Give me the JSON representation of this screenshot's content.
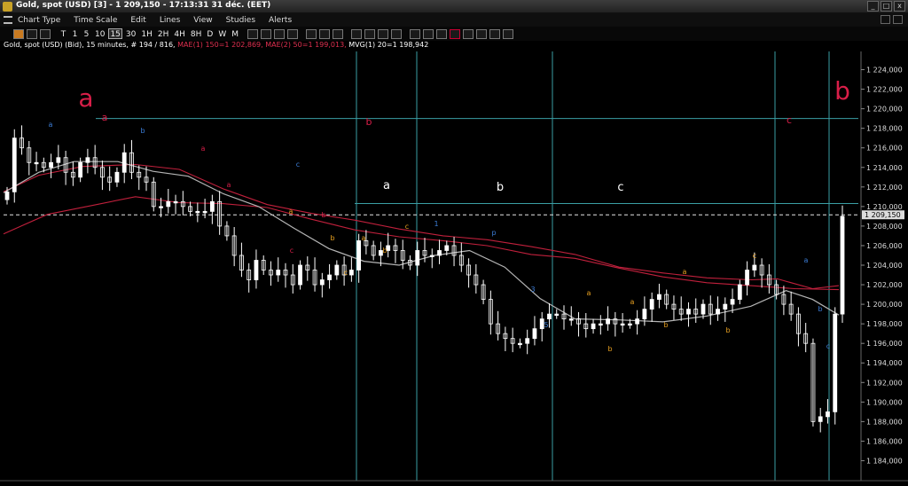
{
  "window": {
    "title": "Gold, spot (USD) [3] - 1 209,150 - 17:13:31  31 déc. (EET)",
    "controls": [
      "_",
      "□",
      "x"
    ]
  },
  "menu": [
    "Chart Type",
    "Time Scale",
    "Edit",
    "Lines",
    "View",
    "Studies",
    "Alerts"
  ],
  "toolbar": {
    "timeframes": [
      "T",
      "1",
      "5",
      "10",
      "15",
      "30",
      "1H",
      "2H",
      "4H",
      "8H",
      "D",
      "W",
      "M"
    ],
    "active_timeframe": "15"
  },
  "legend": {
    "instrument": "Gold, spot (USD) (Bid), 15 minutes, # 194 / 816,",
    "ma1": "MAE(1) 150=1 202,869,",
    "ma2": "MAE(2) 50=1 199,013,",
    "mvg": "MVG(1) 20=1 198,942"
  },
  "colors": {
    "background": "#000000",
    "candle": "#ffffff",
    "ma_red": "#c0203c",
    "ma_gray": "#b4b4b4",
    "cyan_line": "#3a9ea4",
    "wave_red": "#d81e48",
    "wave_orange": "#e8a020",
    "wave_blue": "#3c7ed8",
    "price_tag_bg": "#dcdcdc"
  },
  "chart_data": {
    "type": "candlestick",
    "y_unit": "USD",
    "ylim": [
      1182500,
      1225500
    ],
    "y_ticks": [
      "1 224,000",
      "1 222,000",
      "1 220,000",
      "1 218,000",
      "1 216,000",
      "1 214,000",
      "1 212,000",
      "1 210,000",
      "1 208,000",
      "1 206,000",
      "1 204,000",
      "1 202,000",
      "1 200,000",
      "1 198,000",
      "1 196,000",
      "1 194,000",
      "1 192,000",
      "1 190,000",
      "1 188,000",
      "1 186,000",
      "1 184,000"
    ],
    "y_tick_values": [
      1224000,
      1222000,
      1220000,
      1218000,
      1216000,
      1214000,
      1212000,
      1210000,
      1208000,
      1206000,
      1204000,
      1202000,
      1200000,
      1198000,
      1196000,
      1194000,
      1192000,
      1190000,
      1188000,
      1186000,
      1184000
    ],
    "last_price": "1 209,150",
    "last_price_value": 1209150,
    "close_series": [
      1211500,
      1217000,
      1216000,
      1214500,
      1214500,
      1214000,
      1214500,
      1215000,
      1213500,
      1213000,
      1214500,
      1215000,
      1214000,
      1213000,
      1212500,
      1213500,
      1215500,
      1213500,
      1213000,
      1212500,
      1210000,
      1210000,
      1210500,
      1210500,
      1210000,
      1209500,
      1209500,
      1209500,
      1210500,
      1208000,
      1207000,
      1205000,
      1203500,
      1202500,
      1204500,
      1203500,
      1203000,
      1203500,
      1203000,
      1202000,
      1204000,
      1203500,
      1202000,
      1202500,
      1203000,
      1204000,
      1203000,
      1203500,
      1206500,
      1206000,
      1205000,
      1205500,
      1206000,
      1205500,
      1204500,
      1204000,
      1205500,
      1205000,
      1205000,
      1205500,
      1206000,
      1205000,
      1204000,
      1203000,
      1202000,
      1200500,
      1198000,
      1197000,
      1196500,
      1196000,
      1196000,
      1196500,
      1197500,
      1198500,
      1199000,
      1199000,
      1198500,
      1198500,
      1198000,
      1197500,
      1198000,
      1198000,
      1198500,
      1198000,
      1198000,
      1198000,
      1198500,
      1199500,
      1200500,
      1201000,
      1200000,
      1199500,
      1199000,
      1199500,
      1199000,
      1200000,
      1199000,
      1199500,
      1200000,
      1200500,
      1202000,
      1203500,
      1204000,
      1203000,
      1202000,
      1201000,
      1200000,
      1199000,
      1197000,
      1196000,
      1188000,
      1188500,
      1189000,
      1199000,
      1209000
    ],
    "ma_series": [
      {
        "name": "MAE(1) 150",
        "values": [
          [
            0,
            1207200
          ],
          [
            50,
            1209200
          ],
          [
            100,
            1210100
          ],
          [
            150,
            1211000
          ],
          [
            200,
            1210400
          ],
          [
            250,
            1210300
          ],
          [
            300,
            1209900
          ],
          [
            350,
            1208700
          ],
          [
            400,
            1207600
          ],
          [
            450,
            1206900
          ],
          [
            500,
            1206500
          ],
          [
            550,
            1206000
          ],
          [
            600,
            1205100
          ],
          [
            650,
            1204700
          ],
          [
            700,
            1203700
          ],
          [
            750,
            1202800
          ],
          [
            800,
            1202200
          ],
          [
            850,
            1201900
          ],
          [
            900,
            1201600
          ],
          [
            950,
            1201500
          ]
        ]
      },
      {
        "name": "MAE(2) 50",
        "values": [
          [
            0,
            1211500
          ],
          [
            40,
            1213200
          ],
          [
            90,
            1214100
          ],
          [
            150,
            1214300
          ],
          [
            200,
            1213800
          ],
          [
            250,
            1211800
          ],
          [
            300,
            1210200
          ],
          [
            350,
            1209300
          ],
          [
            400,
            1208600
          ],
          [
            450,
            1207700
          ],
          [
            500,
            1207000
          ],
          [
            550,
            1206600
          ],
          [
            600,
            1205900
          ],
          [
            650,
            1205100
          ],
          [
            700,
            1203800
          ],
          [
            750,
            1203200
          ],
          [
            800,
            1202700
          ],
          [
            850,
            1202500
          ],
          [
            880,
            1202600
          ],
          [
            920,
            1201600
          ],
          [
            950,
            1201900
          ]
        ]
      },
      {
        "name": "MVG(1) 20",
        "values": [
          [
            0,
            1211400
          ],
          [
            40,
            1213500
          ],
          [
            80,
            1214600
          ],
          [
            130,
            1214600
          ],
          [
            170,
            1213600
          ],
          [
            210,
            1213100
          ],
          [
            250,
            1211300
          ],
          [
            290,
            1210000
          ],
          [
            330,
            1207800
          ],
          [
            370,
            1205700
          ],
          [
            410,
            1204400
          ],
          [
            450,
            1204000
          ],
          [
            490,
            1205000
          ],
          [
            530,
            1205500
          ],
          [
            570,
            1203800
          ],
          [
            610,
            1200600
          ],
          [
            650,
            1198500
          ],
          [
            700,
            1198400
          ],
          [
            750,
            1198200
          ],
          [
            800,
            1198800
          ],
          [
            850,
            1199800
          ],
          [
            890,
            1201400
          ],
          [
            920,
            1200500
          ],
          [
            950,
            1198900
          ]
        ]
      }
    ],
    "vertical_lines_x_frac": [],
    "horizontal_lines": [
      {
        "label": "top",
        "value": 1219000
      },
      {
        "label": "middle",
        "value": 1210300
      }
    ],
    "dashed_price_line": 1209150,
    "annotations_big": [
      {
        "text": "a",
        "color_key": "wave_red"
      },
      {
        "text": "b",
        "color_key": "wave_red"
      }
    ],
    "annotations": [
      {
        "text": "a",
        "color_key": "wave_red"
      },
      {
        "text": "b",
        "color_key": "wave_red"
      },
      {
        "text": "c",
        "color_key": "wave_red"
      },
      {
        "text": "a",
        "color_key": "wave_red"
      },
      {
        "text": "a",
        "color_key": "wave_blue"
      },
      {
        "text": "b",
        "color_key": "wave_blue"
      },
      {
        "text": "a",
        "color_key": "wave_red"
      },
      {
        "text": "b",
        "color_key": "wave_red"
      },
      {
        "text": "c",
        "color_key": "wave_blue"
      },
      {
        "text": "c",
        "color_key": "wave_red"
      },
      {
        "text": "a",
        "color_key": "candle"
      },
      {
        "text": "b",
        "color_key": "candle"
      },
      {
        "text": "c",
        "color_key": "candle"
      },
      {
        "text": "a",
        "color_key": "wave_orange"
      },
      {
        "text": "b",
        "color_key": "wave_orange"
      },
      {
        "text": "c",
        "color_key": "wave_orange"
      },
      {
        "text": "a",
        "color_key": "wave_orange"
      },
      {
        "text": "b",
        "color_key": "wave_orange"
      },
      {
        "text": "c",
        "color_key": "wave_orange"
      },
      {
        "text": "1",
        "color_key": "wave_blue"
      },
      {
        "text": "p",
        "color_key": "wave_blue"
      },
      {
        "text": "3",
        "color_key": "wave_blue"
      },
      {
        "text": "5",
        "color_key": "wave_blue"
      },
      {
        "text": "a",
        "color_key": "wave_orange"
      },
      {
        "text": "a",
        "color_key": "wave_orange"
      },
      {
        "text": "b",
        "color_key": "wave_orange"
      },
      {
        "text": "a",
        "color_key": "wave_orange"
      },
      {
        "text": "b",
        "color_key": "wave_orange"
      },
      {
        "text": "b",
        "color_key": "wave_orange"
      },
      {
        "text": "c",
        "color_key": "wave_orange"
      },
      {
        "text": "a",
        "color_key": "wave_blue"
      },
      {
        "text": "b",
        "color_key": "wave_blue"
      },
      {
        "text": "c",
        "color_key": "wave_blue"
      }
    ]
  }
}
